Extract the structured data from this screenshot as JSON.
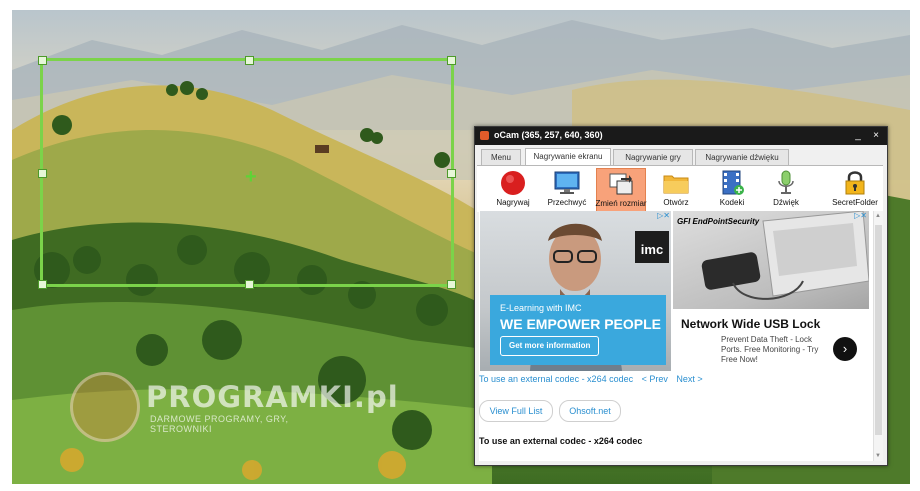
{
  "watermark": {
    "title": "PROGRAMKI.pl",
    "subtitle": "DARMOWE PROGRAMY, GRY, STEROWNIKI"
  },
  "window": {
    "title": "oCam (365, 257, 640, 360)",
    "minimize": "_",
    "close": "×"
  },
  "tabs": [
    {
      "label": "Menu"
    },
    {
      "label": "Nagrywanie ekranu"
    },
    {
      "label": "Nagrywanie gry"
    },
    {
      "label": "Nagrywanie dźwięku"
    }
  ],
  "toolbar": [
    {
      "label": "Nagrywaj",
      "icon": "record-icon"
    },
    {
      "label": "Przechwyć",
      "icon": "monitor-icon"
    },
    {
      "label": "Zmień rozmiar",
      "icon": "resize-icon"
    },
    {
      "label": "Otwórz",
      "icon": "folder-icon"
    },
    {
      "label": "Kodeki",
      "icon": "film-icon"
    },
    {
      "label": "Dźwięk",
      "icon": "microphone-icon"
    },
    {
      "label": "SecretFolder",
      "icon": "lock-icon"
    }
  ],
  "ad_left": {
    "logo": "imc",
    "small_text": "E-Learning with IMC",
    "headline": "WE EMPOWER PEOPLE",
    "cta": "Get more information"
  },
  "ad_right": {
    "brand": "GFI EndPointSecurity",
    "headline": "Network Wide USB Lock",
    "description": "Prevent Data Theft - Lock Ports. Free Monitoring - Try Free Now!",
    "arrow": "›"
  },
  "links": {
    "codec_link": "To use an external codec - x264 codec",
    "prev": "< Prev",
    "next": "Next >"
  },
  "buttons": {
    "view_full_list": "View Full List",
    "ohsoft": "Ohsoft.net"
  },
  "bottom_title": "To use an external codec - x264 codec",
  "colors": {
    "capture_frame": "#7bd34a",
    "selected_tool": "#f8a27a",
    "link": "#2a8fd0"
  }
}
